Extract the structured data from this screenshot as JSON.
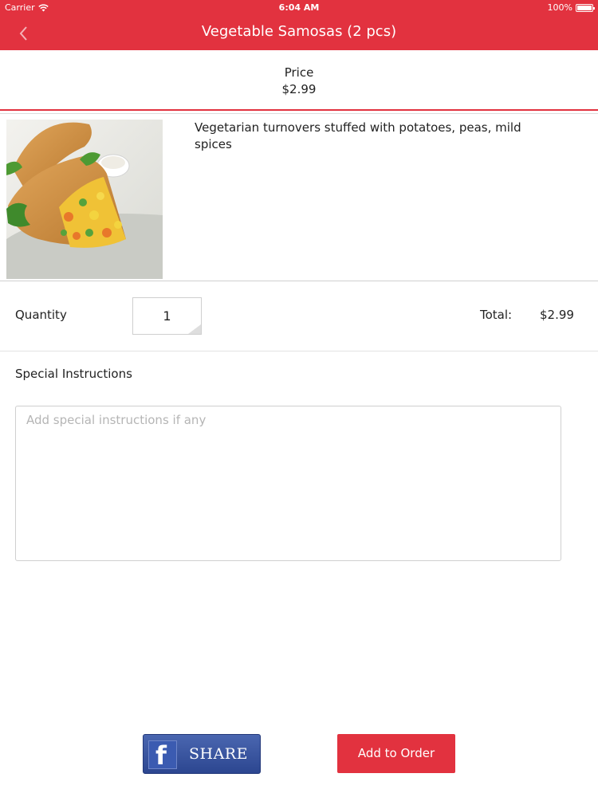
{
  "status_bar": {
    "carrier": "Carrier",
    "time": "6:04 AM",
    "battery": "100%"
  },
  "nav": {
    "title": "Vegetable Samosas (2 pcs)",
    "back_icon": "chevron-left-icon"
  },
  "price": {
    "label": "Price",
    "value": "$2.99"
  },
  "item": {
    "image_alt": "samosa-image",
    "description": "Vegetarian turnovers stuffed with potatoes, peas, mild spices"
  },
  "quantity": {
    "label": "Quantity",
    "value": "1"
  },
  "total": {
    "label": "Total:",
    "value": "$2.99"
  },
  "instructions": {
    "label": "Special Instructions",
    "placeholder": "Add special instructions if any"
  },
  "actions": {
    "share_label": "SHARE",
    "add_label": "Add to Order"
  },
  "colors": {
    "accent": "#e2323f",
    "facebook": "#3b5998"
  }
}
